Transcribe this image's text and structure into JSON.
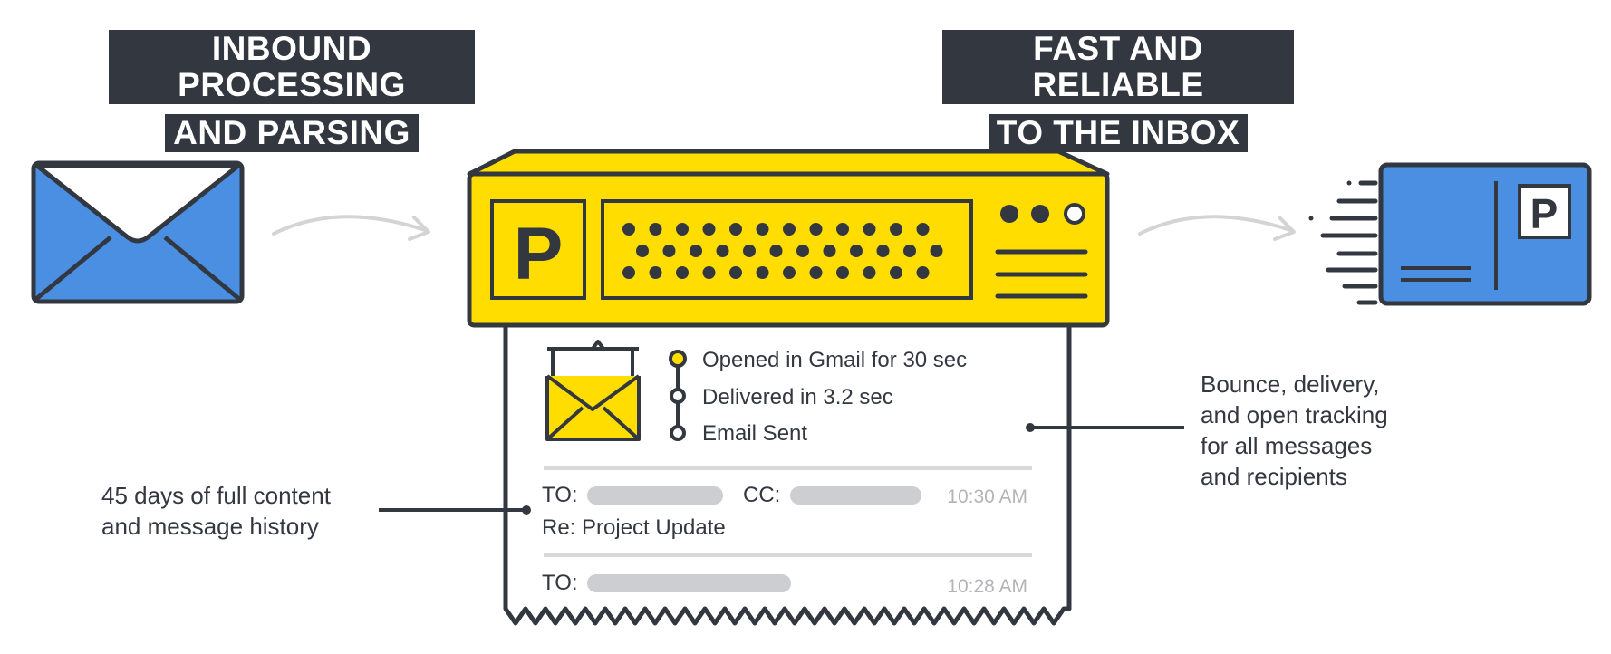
{
  "headings": {
    "inbound_line1": "INBOUND PROCESSING",
    "inbound_line2": "AND PARSING",
    "fast_line1": "FAST AND RELIABLE",
    "fast_line2": "TO THE INBOX"
  },
  "server": {
    "logo_letter": "P"
  },
  "postcard": {
    "stamp_letter": "P"
  },
  "tracking": {
    "steps": [
      {
        "label": "Opened in Gmail for 30 sec",
        "status": "active"
      },
      {
        "label": "Delivered in 3.2 sec",
        "status": "done"
      },
      {
        "label": "Email Sent",
        "status": "done"
      }
    ]
  },
  "history": {
    "messages": [
      {
        "to_label": "TO:",
        "cc_label": "CC:",
        "time": "10:30 AM",
        "subject": "Re: Project Update"
      },
      {
        "to_label": "TO:",
        "time": "10:28 AM"
      }
    ]
  },
  "callouts": {
    "left": [
      "45 days of full content",
      "and message history"
    ],
    "right": [
      "Bounce, delivery,",
      "and open tracking",
      "for all messages",
      "and recipients"
    ]
  },
  "colors": {
    "dark": "#333740",
    "yellow": "#FFDD00",
    "blue": "#4A8FE2",
    "gray_bar": "#CDCED2",
    "arrow": "#D4D4D4",
    "time_text": "#B4B4B8"
  }
}
